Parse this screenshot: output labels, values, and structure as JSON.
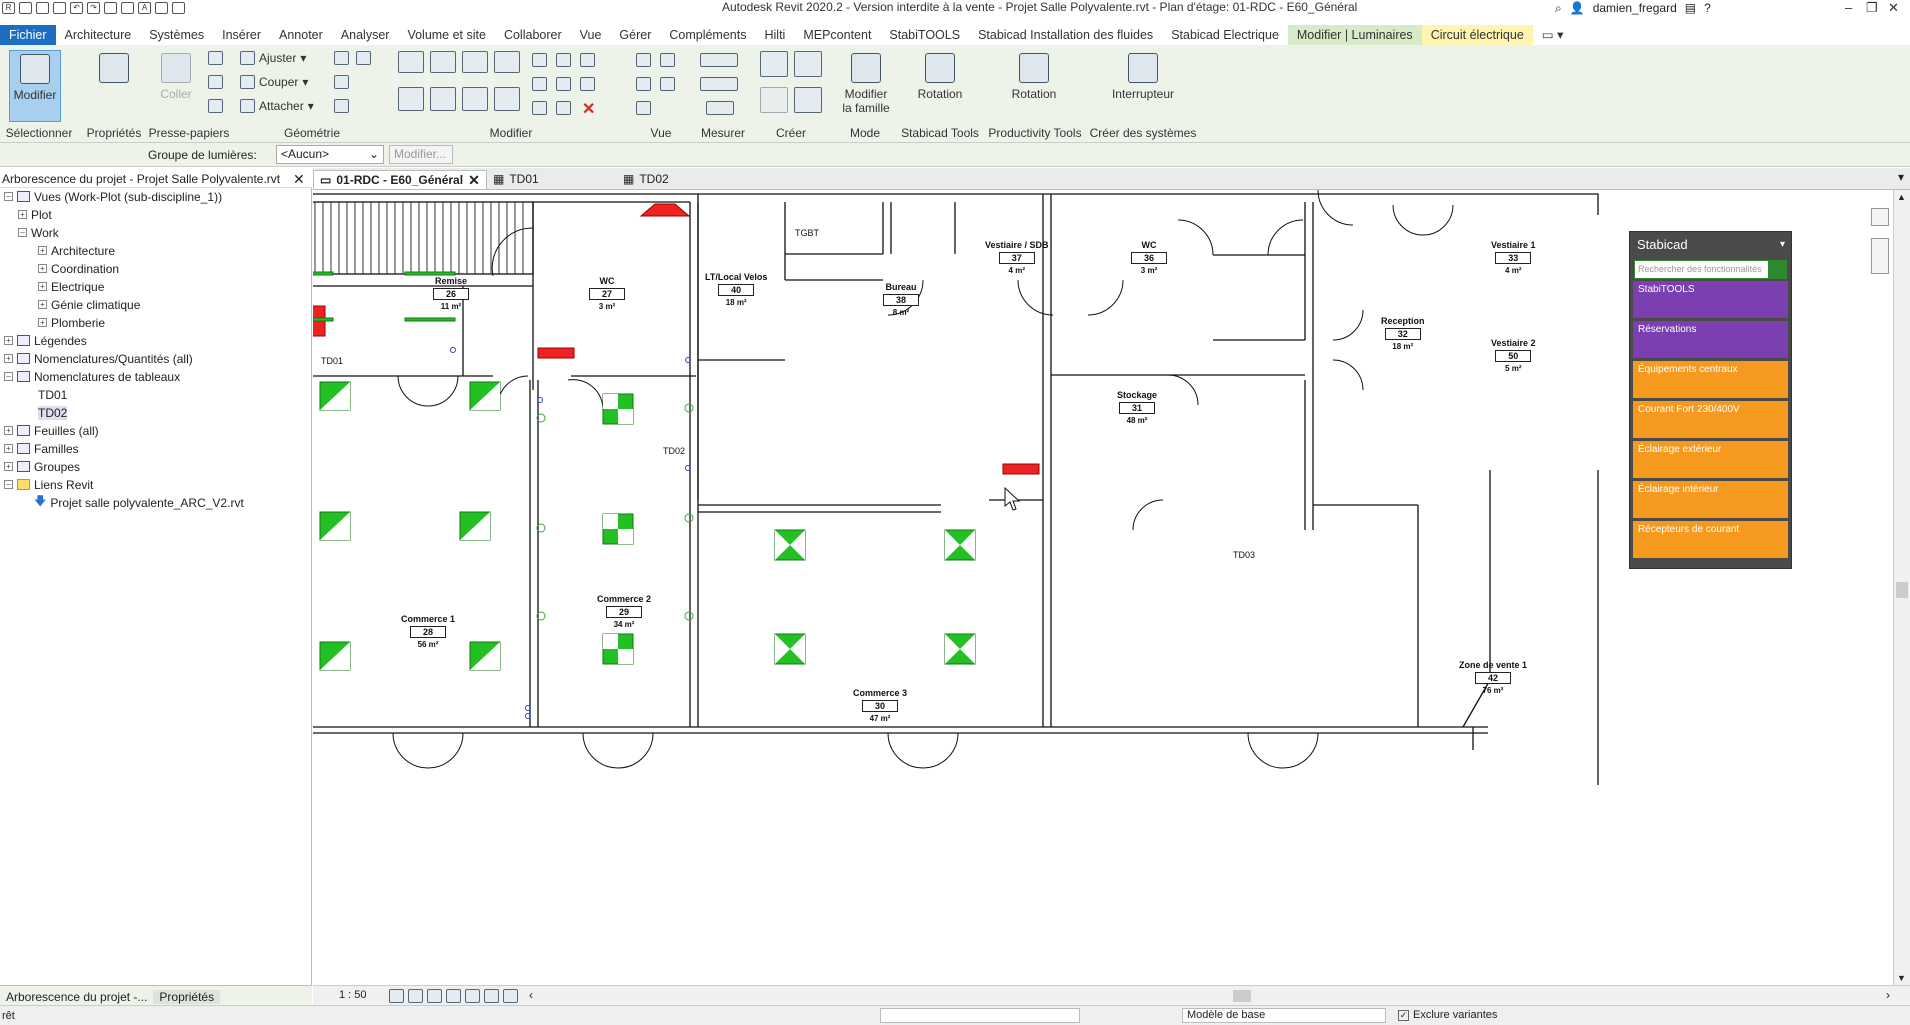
{
  "titlebar": {
    "title": "Autodesk Revit 2020.2 - Version interdite à la vente - Projet Salle Polyvalente.rvt - Plan d'étage: 01-RDC - E60_Général",
    "user": "damien_fregard"
  },
  "menu": {
    "tabs": [
      "Fichier",
      "Architecture",
      "Systèmes",
      "Insérer",
      "Annoter",
      "Analyser",
      "Volume et site",
      "Collaborer",
      "Vue",
      "Gérer",
      "Compléments",
      "Hilti",
      "MEPcontent",
      "StabiTOOLS",
      "Stabicad Installation des fluides",
      "Stabicad Electrique",
      "Modifier | Luminaires",
      "Circuit électrique"
    ]
  },
  "ribbon": {
    "select": {
      "button": "Modifier",
      "label": "Sélectionner"
    },
    "properties": {
      "label": "Propriétés"
    },
    "clipboard": {
      "paste": "Coller",
      "label": "Presse-papiers"
    },
    "geometry": {
      "cut": "Ajuster",
      "cope": "Couper",
      "join": "Attacher",
      "label": "Géométrie"
    },
    "modify": {
      "label": "Modifier"
    },
    "view": {
      "label": "Vue"
    },
    "measure": {
      "label": "Mesurer"
    },
    "create": {
      "label": "Créer"
    },
    "mode": {
      "button1": "Modifier",
      "button2": "la famille",
      "label": "Mode"
    },
    "stabicad_tools": {
      "button": "Rotation",
      "label": "Stabicad Tools"
    },
    "productivity_tools": {
      "button": "Rotation",
      "label": "Productivity Tools"
    },
    "create_systems": {
      "button": "Interrupteur",
      "label": "Créer des systèmes"
    }
  },
  "optionsbar": {
    "group_label": "Groupe de lumières:",
    "group_value": "<Aucun>",
    "modify_button": "Modifier..."
  },
  "project_browser": {
    "header": "Arborescence du projet - Projet Salle Polyvalente.rvt",
    "nodes": [
      "Vues (Work-Plot (sub-discipline_1))",
      "Plot",
      "Work",
      "Architecture",
      "Coordination",
      "Electrique",
      "Génie climatique",
      "Plomberie",
      "Légendes",
      "Nomenclatures/Quantités (all)",
      "Nomenclatures de tableaux",
      "TD01",
      "TD02",
      "Feuilles (all)",
      "Familles",
      "Groupes",
      "Liens Revit",
      "Projet salle polyvalente_ARC_V2.rvt"
    ],
    "tabs": [
      "Arborescence du projet -...",
      "Propriétés"
    ]
  },
  "doc_tabs": [
    "01-RDC - E60_Général",
    "TD01",
    "TD02"
  ],
  "rooms": [
    {
      "name": "Remise",
      "number": "26",
      "area": "11 m²"
    },
    {
      "name": "WC",
      "number": "27",
      "area": "3 m²"
    },
    {
      "name": "LT/Local Velos",
      "number": "40",
      "area": "18 m²"
    },
    {
      "name": "Bureau",
      "number": "38",
      "area": "8 m²"
    },
    {
      "name": "Vestiaire / SDB",
      "number": "37",
      "area": "4 m²"
    },
    {
      "name": "WC",
      "number": "36",
      "area": "3 m²"
    },
    {
      "name": "Stockage",
      "number": "31",
      "area": "48 m²"
    },
    {
      "name": "Reception",
      "number": "32",
      "area": "18 m²"
    },
    {
      "name": "Vestiaire 1",
      "number": "33",
      "area": "4 m²"
    },
    {
      "name": "Vestiaire 2",
      "number": "50",
      "area": "5 m²"
    },
    {
      "name": "Commerce 1",
      "number": "28",
      "area": "56 m²"
    },
    {
      "name": "Commerce 2",
      "number": "29",
      "area": "34 m²"
    },
    {
      "name": "Commerce 3",
      "number": "30",
      "area": "47 m²"
    },
    {
      "name": "Zone de vente 1",
      "number": "42",
      "area": "76 m²"
    }
  ],
  "equipment": [
    "TGBT",
    "TD01",
    "TD02",
    "TD03"
  ],
  "stabicad": {
    "title": "Stabicad",
    "search_placeholder": "Rechercher des fonctionnalités",
    "buttons": [
      {
        "label": "StabiTOOLS",
        "color": "#7b3fb0"
      },
      {
        "label": "Réservations",
        "color": "#7b3fb0"
      },
      {
        "label": "Équipements centraux",
        "color": "#f59a1e"
      },
      {
        "label": "Courant Fort 230/400V",
        "color": "#f59a1e"
      },
      {
        "label": "Éclairage extérieur",
        "color": "#f59a1e"
      },
      {
        "label": "Éclairage intérieur",
        "color": "#f59a1e"
      },
      {
        "label": "Récepteurs de courant",
        "color": "#f59a1e"
      }
    ]
  },
  "statusbar": {
    "scale": "1 : 50",
    "left_text": "rêt",
    "model": "Modèle de base",
    "exclude": "Exclure variantes"
  }
}
